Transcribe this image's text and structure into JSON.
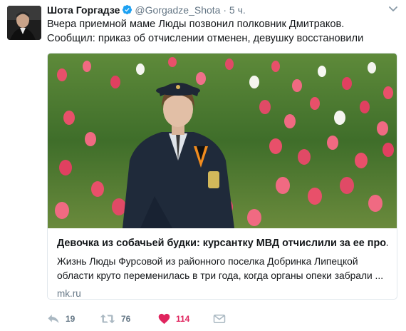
{
  "tweet": {
    "author_name": "Шота Горгадзе",
    "handle": "@Gorgadze_Shota",
    "separator": "·",
    "time": "5 ч.",
    "text": "Вчера приемной маме Люды позвонил полковник Дмитраков. Сообщил: приказ об отчислении отменен, девушку восстановили"
  },
  "card": {
    "title": "Девочка из собачьей будки: курсантку МВД отчислили за ее про...",
    "description": "Жизнь Люды Фурсовой из районного поселка Добринка Липецкой области круто переменилась в три года, когда органы опеки забрали ...",
    "domain": "mk.ru"
  },
  "actions": {
    "reply_count": "19",
    "retweet_count": "76",
    "like_count": "114"
  },
  "icons": {
    "verified": "verified-badge-icon",
    "caret": "chevron-down-icon",
    "reply": "reply-icon",
    "retweet": "retweet-icon",
    "like": "heart-icon",
    "dm": "direct-message-icon"
  },
  "colors": {
    "secondary_text": "#657786",
    "verified_blue": "#1da1f2",
    "like_red": "#e0245e",
    "card_border": "#e1e8ed"
  }
}
